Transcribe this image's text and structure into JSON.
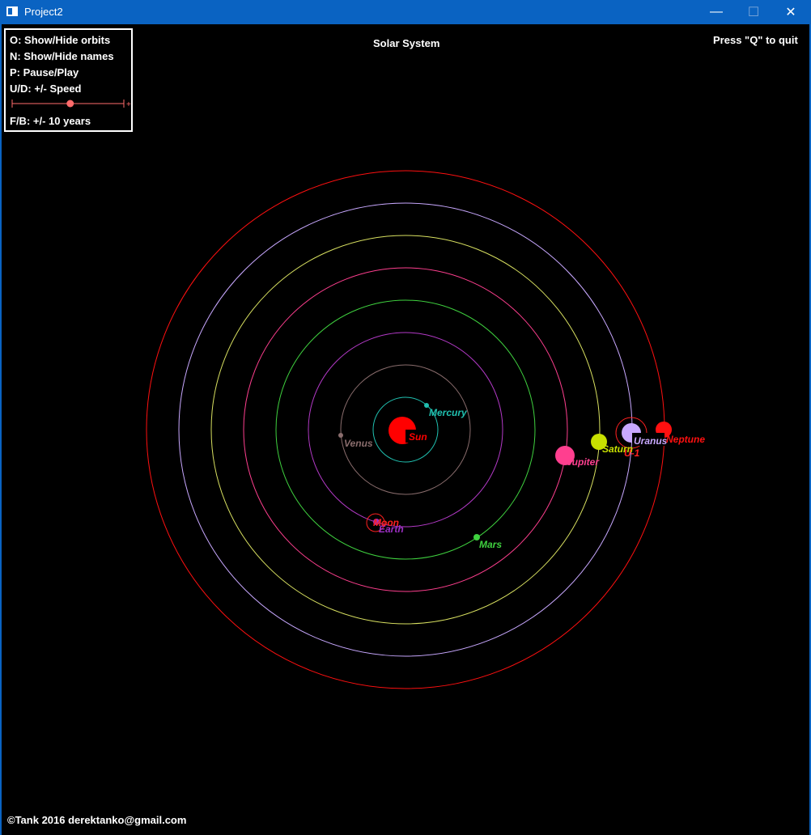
{
  "window": {
    "title": "Project2",
    "minimize_glyph": "—",
    "maximize_glyph": "☐",
    "close_glyph": "✕",
    "titlebar_color": "#0a63c2"
  },
  "header": {
    "title": "Solar System",
    "quit_hint": "Press \"Q\" to quit"
  },
  "controls": {
    "orbits": "O: Show/Hide orbits",
    "names": "N: Show/Hide names",
    "pause": "P: Pause/Play",
    "speed": "U/D: +/- Speed",
    "years": "F/B: +/- 10 years",
    "speed_level": 0.52,
    "slider_color": "#ff6b6b"
  },
  "footer": {
    "copyright": "©Tank 2016  derektanko@gmail.com"
  },
  "bodies": {
    "sun": {
      "name": "Sun",
      "color": "#ff0000"
    },
    "mercury": {
      "name": "Mercury",
      "color": "#20c0b0"
    },
    "venus": {
      "name": "Venus",
      "color": "#8a6d6d"
    },
    "earth": {
      "name": "Earth",
      "color": "#9c2fc4"
    },
    "moon": {
      "name": "Moon",
      "color": "#ff2020"
    },
    "mars": {
      "name": "Mars",
      "color": "#3fd13f"
    },
    "jupiter": {
      "name": "Jupiter",
      "color": "#ff3f8f"
    },
    "saturn": {
      "name": "Saturn",
      "color": "#c8e000"
    },
    "uranus": {
      "name": "Uranus",
      "color": "#c8a8ff"
    },
    "uranus_moon": {
      "name": "U-1",
      "color": "#ff2020"
    },
    "neptune": {
      "name": "Neptune",
      "color": "#ff1010"
    }
  }
}
